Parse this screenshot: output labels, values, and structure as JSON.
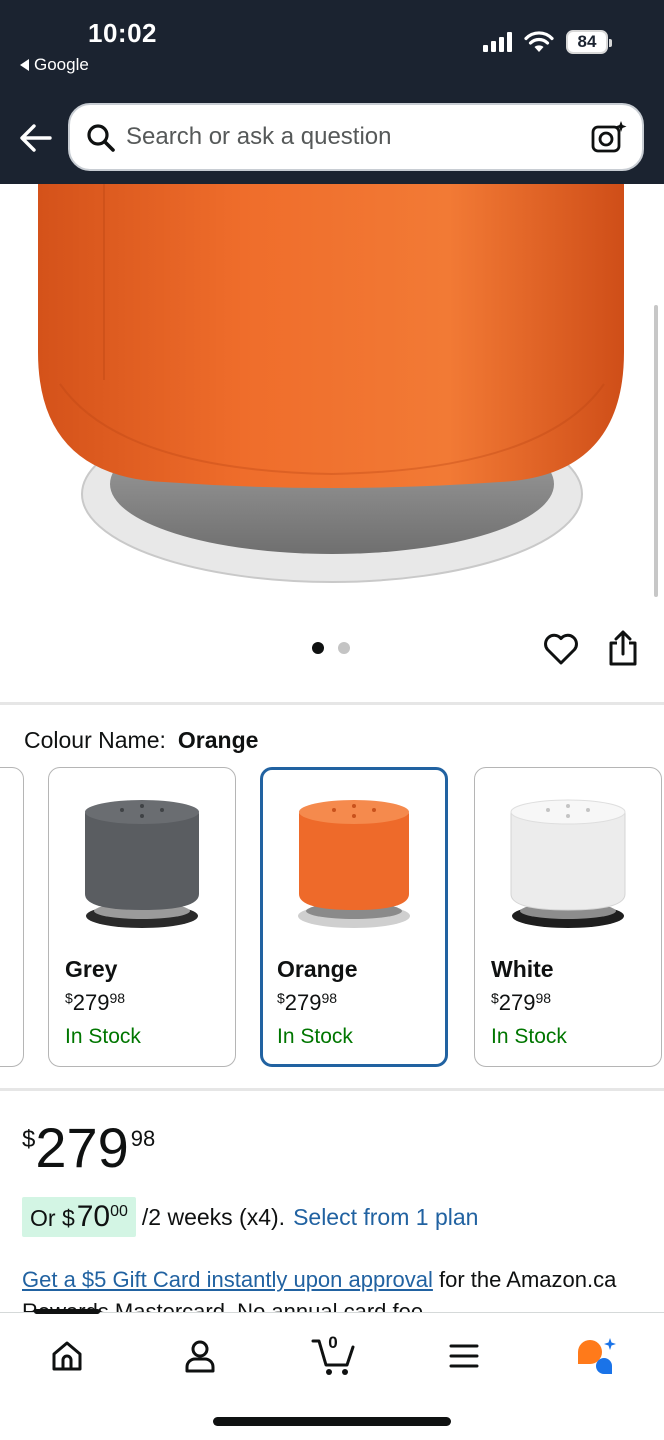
{
  "status_bar": {
    "time": "10:02",
    "back_app": "Google",
    "battery": "84"
  },
  "search": {
    "placeholder": "Search or ask a question"
  },
  "gallery": {
    "image_count": 2,
    "active_index": 0
  },
  "colour": {
    "label": "Colour Name:",
    "selected": "Orange",
    "options": [
      {
        "name": "Grey",
        "currency": "$",
        "whole": "279",
        "cents": "98",
        "stock": "In Stock",
        "color": "#5a5d61"
      },
      {
        "name": "Orange",
        "currency": "$",
        "whole": "279",
        "cents": "98",
        "stock": "In Stock",
        "color": "#ee6a2a"
      },
      {
        "name": "White",
        "currency": "$",
        "whole": "279",
        "cents": "98",
        "stock": "In Stock",
        "color": "#eeeeee"
      }
    ]
  },
  "price": {
    "currency": "$",
    "whole": "279",
    "cents": "98"
  },
  "installment": {
    "prefix": "Or $",
    "whole": "70",
    "cents": "00",
    "suffix": "/2 weeks (x4).",
    "link": "Select from 1 plan"
  },
  "promo": {
    "link": "Get a $5 Gift Card instantly upon approval",
    "text": " for the Amazon.ca Rewards Mastercard. No annual card fee."
  },
  "nav": {
    "cart_count": "0"
  },
  "colors": {
    "header_bg": "#1b2330",
    "link": "#2162a1",
    "in_stock": "#007600",
    "selected_border": "#2162a1",
    "installment_chip": "#d3f5e4"
  }
}
